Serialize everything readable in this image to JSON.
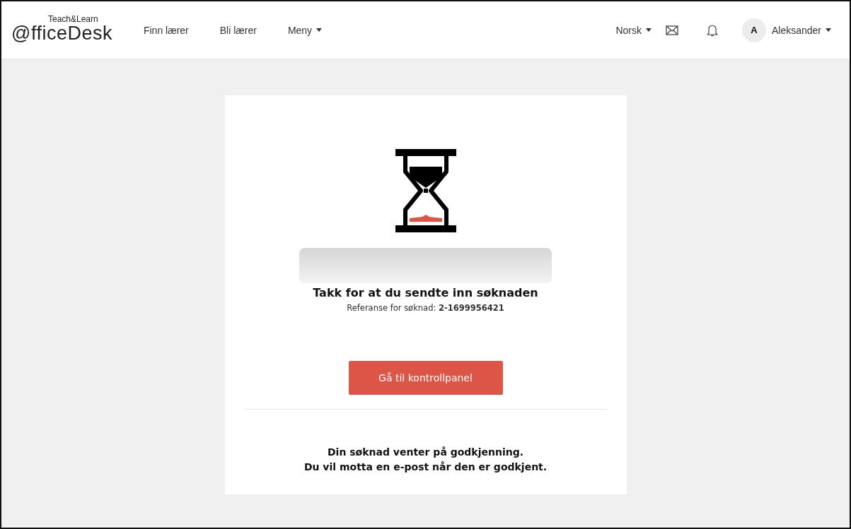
{
  "header": {
    "logo": {
      "main": "@fficeDesk",
      "tagline": "Teach&Learn"
    },
    "nav": [
      {
        "label": "Finn lærer",
        "dropdown": false
      },
      {
        "label": "Bli lærer",
        "dropdown": false
      },
      {
        "label": "Meny",
        "dropdown": true
      }
    ],
    "language": {
      "label": "Norsk",
      "dropdown": true
    },
    "user": {
      "initial": "A",
      "name": "Aleksander",
      "dropdown": true
    }
  },
  "card": {
    "title": "Takk for at du sendte inn søknaden",
    "reference": "Referanse for søknad: **2-1699956421**",
    "button": "Gå til kontrollpanel",
    "message": [
      "Din søknad venter på godkjenning.",
      "Du vil motta en e-post når den er godkjent."
    ]
  }
}
